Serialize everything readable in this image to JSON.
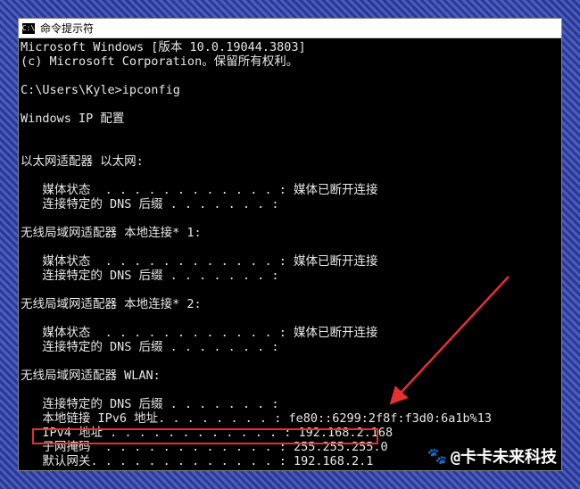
{
  "titlebar": {
    "icon_text": "C:\\",
    "title": "命令提示符"
  },
  "terminal": {
    "line_version": "Microsoft Windows [版本 10.0.19044.3803]",
    "line_copyright": "(c) Microsoft Corporation。保留所有权利。",
    "prompt_path": "C:\\Users\\Kyle>",
    "command": "ipconfig",
    "ip_config_header": "Windows IP 配置",
    "adapters": [
      {
        "header": "以太网适配器 以太网:",
        "rows": [
          {
            "label": "   媒体状态  . . . . . . . . . . . . : ",
            "value": "媒体已断开连接"
          },
          {
            "label": "   连接特定的 DNS 后缀 . . . . . . . :",
            "value": ""
          }
        ]
      },
      {
        "header": "无线局域网适配器 本地连接* 1:",
        "rows": [
          {
            "label": "   媒体状态  . . . . . . . . . . . . : ",
            "value": "媒体已断开连接"
          },
          {
            "label": "   连接特定的 DNS 后缀 . . . . . . . :",
            "value": ""
          }
        ]
      },
      {
        "header": "无线局域网适配器 本地连接* 2:",
        "rows": [
          {
            "label": "   媒体状态  . . . . . . . . . . . . : ",
            "value": "媒体已断开连接"
          },
          {
            "label": "   连接特定的 DNS 后缀 . . . . . . . :",
            "value": ""
          }
        ]
      },
      {
        "header": "无线局域网适配器 WLAN:",
        "rows": [
          {
            "label": "   连接特定的 DNS 后缀 . . . . . . . :",
            "value": ""
          },
          {
            "label": "   本地链接 IPv6 地址. . . . . . . . : ",
            "value": "fe80::6299:2f8f:f3d0:6a1b%13"
          },
          {
            "label": "   IPv4 地址 . . . . . . . . . . . . : ",
            "value": "192.168.2.168"
          },
          {
            "label": "   子网掩码  . . . . . . . . . . . . : ",
            "value": "255.255.255.0"
          },
          {
            "label": "   默认网关. . . . . . . . . . . . . : ",
            "value": "192.168.2.1"
          }
        ]
      }
    ]
  },
  "watermark": {
    "paw": "🐾",
    "text": "@卡卡未来科技"
  },
  "annotation": {
    "highlight_target": "默认网关",
    "arrow_color": "#e43131"
  }
}
